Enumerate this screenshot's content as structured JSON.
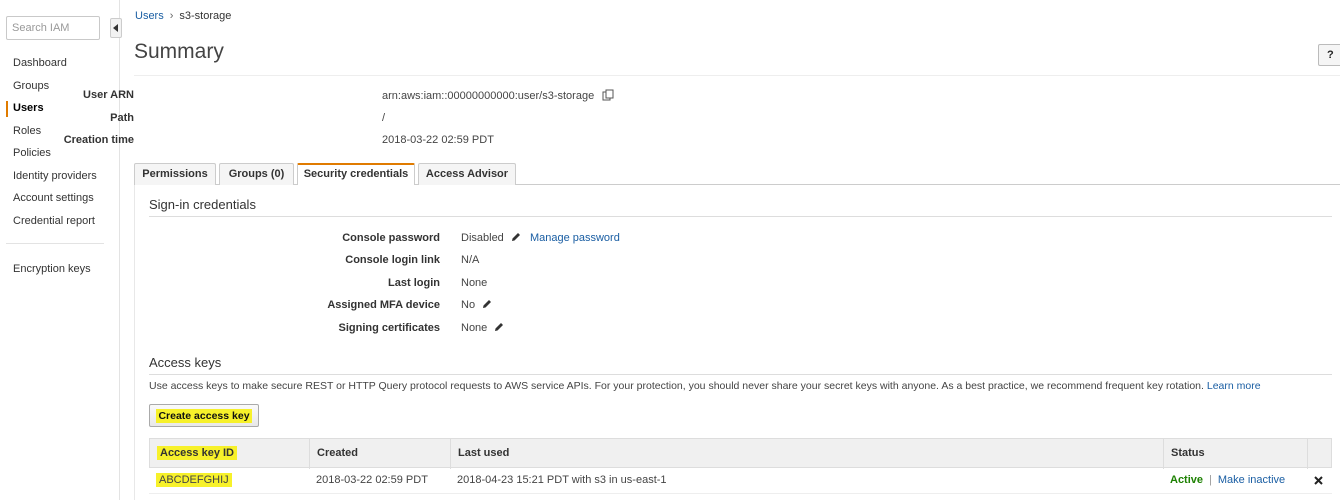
{
  "sidebar": {
    "search_placeholder": "Search IAM",
    "items": [
      {
        "label": "Dashboard"
      },
      {
        "label": "Groups"
      },
      {
        "label": "Users"
      },
      {
        "label": "Roles"
      },
      {
        "label": "Policies"
      },
      {
        "label": "Identity providers"
      },
      {
        "label": "Account settings"
      },
      {
        "label": "Credential report"
      }
    ],
    "active_item": "Users",
    "secondary_item": "Encryption keys"
  },
  "breadcrumb": {
    "parent": "Users",
    "current": "s3-storage"
  },
  "page": {
    "title": "Summary",
    "help_label": "?"
  },
  "summary": {
    "arn_label": "User ARN",
    "arn_value": "arn:aws:iam::00000000000:user/s3-storage",
    "path_label": "Path",
    "path_value": "/",
    "creation_label": "Creation time",
    "creation_value": "2018-03-22 02:59 PDT"
  },
  "tabs": [
    {
      "label": "Permissions"
    },
    {
      "label": "Groups (0)"
    },
    {
      "label": "Security credentials"
    },
    {
      "label": "Access Advisor"
    }
  ],
  "active_tab": "Security credentials",
  "signin": {
    "title": "Sign-in credentials",
    "rows": [
      {
        "label": "Console password",
        "value": "Disabled"
      },
      {
        "label": "Console login link",
        "value": "N/A"
      },
      {
        "label": "Last login",
        "value": "None"
      },
      {
        "label": "Assigned MFA device",
        "value": "No"
      },
      {
        "label": "Signing certificates",
        "value": "None"
      }
    ],
    "manage_password_link": "Manage password"
  },
  "access_keys": {
    "title": "Access keys",
    "description": "Use access keys to make secure REST or HTTP Query protocol requests to AWS service APIs. For your protection, you should never share your secret keys with anyone. As a best practice, we recommend frequent key rotation.",
    "learn_more": "Learn more",
    "create_button": "Create access key",
    "columns": [
      "Access key ID",
      "Created",
      "Last used",
      "Status"
    ],
    "rows": [
      {
        "id": "ABCDEFGHIJ",
        "created": "2018-03-22 02:59 PDT",
        "last_used": "2018-04-23 15:21 PDT with s3 in us-east-1",
        "status": "Active",
        "action": "Make inactive"
      }
    ],
    "separator": "|"
  },
  "colors": {
    "accent": "#e07b00",
    "link": "#1a5ea3",
    "active_status": "#1d8102",
    "highlight": "#f7f12a"
  }
}
